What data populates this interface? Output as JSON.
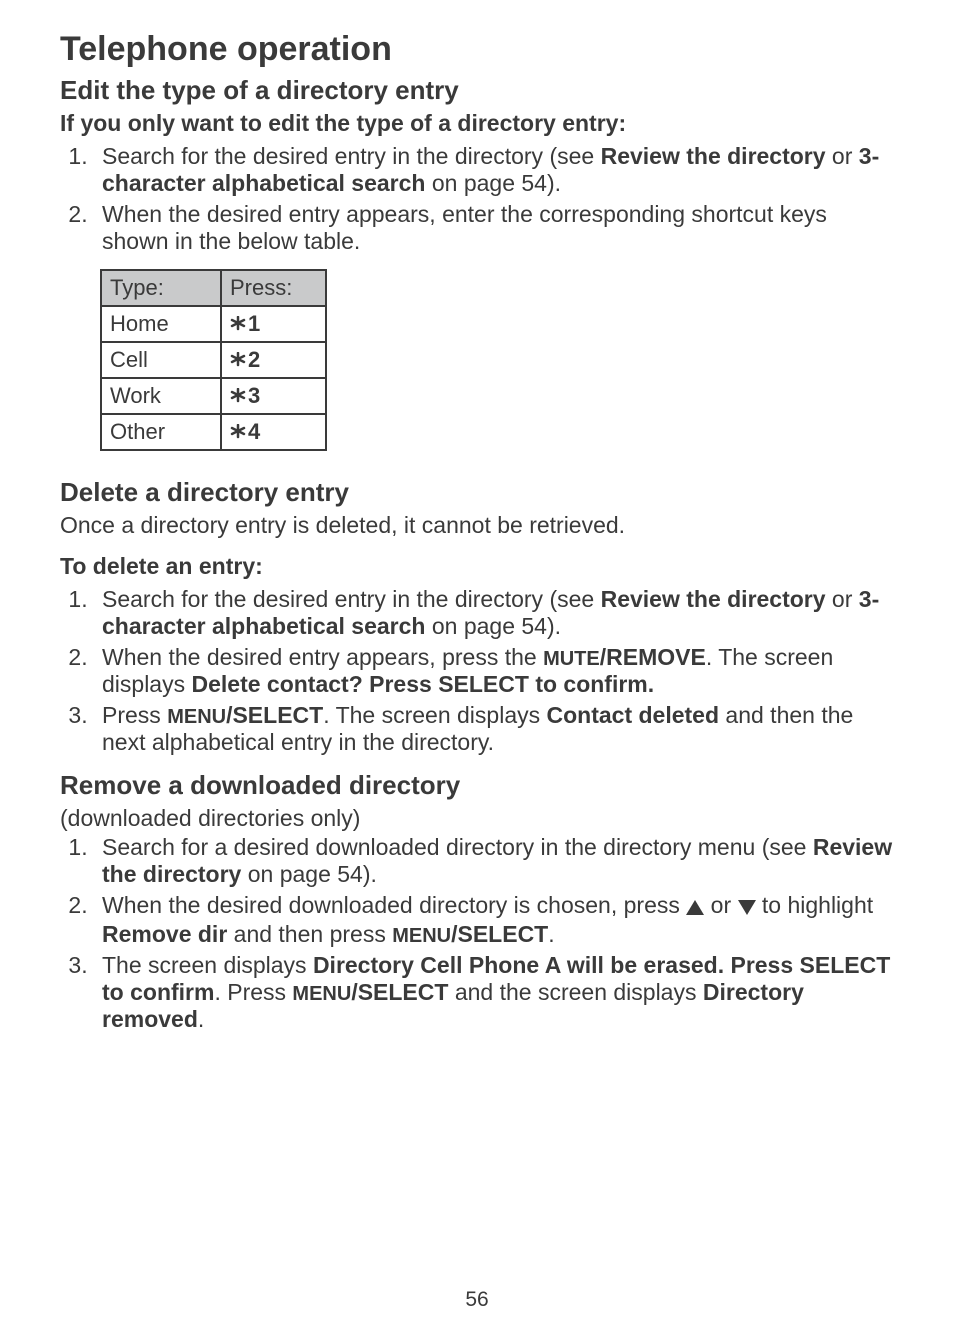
{
  "page": {
    "title": "Telephone operation",
    "pageNumber": "56"
  },
  "edit": {
    "heading": "Edit the type of a directory entry",
    "intro": "If you only want to edit the type of a directory entry:",
    "steps": {
      "s1_a": "Search for the desired entry in the directory (see ",
      "s1_b1": "Review the directory",
      "s1_c": " or ",
      "s1_b2": "3-character alphabetical search",
      "s1_d": " on page 54).",
      "s2": "When the desired entry appears, enter the corresponding shortcut keys shown in the below table."
    },
    "table": {
      "h1": "Type:",
      "h2": "Press:",
      "rows": [
        {
          "type": "Home",
          "num": "1"
        },
        {
          "type": "Cell",
          "num": "2"
        },
        {
          "type": "Work",
          "num": "3"
        },
        {
          "type": "Other",
          "num": "4"
        }
      ]
    }
  },
  "del": {
    "heading": "Delete a directory entry",
    "intro": "Once a directory entry is deleted, it cannot be retrieved.",
    "sub": "To delete an entry:",
    "steps": {
      "s1_a": "Search for the desired entry in the directory (see ",
      "s1_b1": "Review the directory",
      "s1_c": " or ",
      "s1_b2": "3-character alphabetical search",
      "s1_d": " on page 54).",
      "s2_a": "When the desired entry appears, press the ",
      "s2_sc": "MUTE",
      "s2_b": "/REMOVE",
      "s2_c": ". The screen displays ",
      "s2_d": "Delete contact? Press SELECT to confirm.",
      "s3_a": "Press ",
      "s3_sc": "MENU",
      "s3_b": "/SELECT",
      "s3_c": ". The screen displays ",
      "s3_d": "Contact deleted",
      "s3_e": " and then the next alphabetical entry in the directory."
    }
  },
  "rem": {
    "heading": "Remove a downloaded directory",
    "intro": "(downloaded directories only)",
    "steps": {
      "s1_a": "Search for a desired downloaded directory in the directory menu (see ",
      "s1_b": "Review the directory",
      "s1_c": " on page 54).",
      "s2_a": "When the desired downloaded directory is chosen, press ",
      "s2_b": " or ",
      "s2_c": " to highlight ",
      "s2_d": "Remove dir",
      "s2_e": " and then press ",
      "s2_sc": "MENU",
      "s2_f": "/SELECT",
      "s2_g": ".",
      "s3_a": "The screen displays ",
      "s3_b": "Directory Cell Phone A will be erased. Press SELECT to confirm",
      "s3_c": ". Press ",
      "s3_sc": "MENU",
      "s3_d": "/SELECT",
      "s3_e": " and the screen displays ",
      "s3_f": "Directory removed",
      "s3_g": "."
    }
  }
}
